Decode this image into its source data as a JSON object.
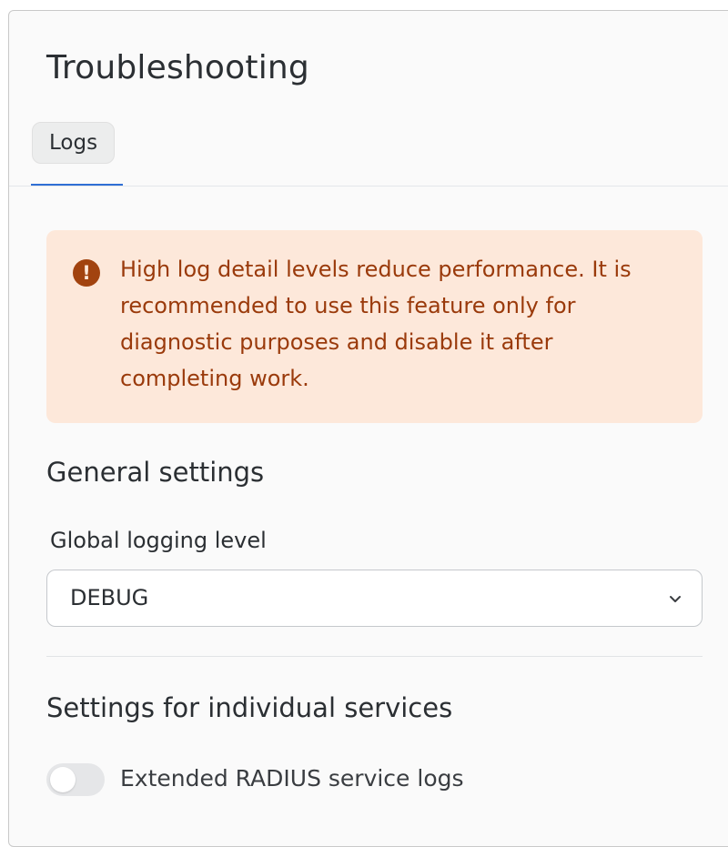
{
  "page": {
    "title": "Troubleshooting"
  },
  "tabs": [
    {
      "label": "Logs",
      "active": true
    }
  ],
  "alert": {
    "icon": "exclamation-circle-icon",
    "text": "High log detail levels reduce performance. It is recommended to use this feature only for diagnostic purposes and disable it after completing work."
  },
  "general_settings": {
    "heading": "General settings",
    "global_logging_level": {
      "label": "Global logging level",
      "value": "DEBUG"
    }
  },
  "services": {
    "heading": "Settings for individual services",
    "toggles": [
      {
        "label": "Extended RADIUS service logs",
        "enabled": false
      }
    ]
  },
  "colors": {
    "accent": "#2f6fd4",
    "alert_background": "#fde8da",
    "alert_text": "#9a3a0b",
    "alert_icon": "#a2430f"
  }
}
